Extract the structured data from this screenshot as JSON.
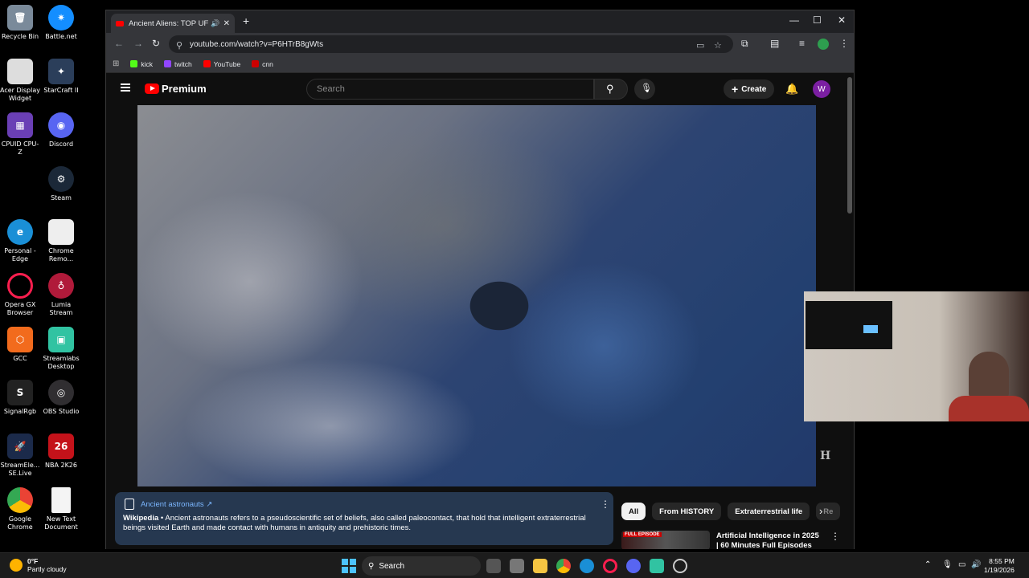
{
  "desktop": {
    "icons": [
      {
        "label": "Recycle Bin"
      },
      {
        "label": "Battle.net"
      },
      {
        "label": "Acer Display Widget"
      },
      {
        "label": "StarCraft II"
      },
      {
        "label": "CPUID CPU-Z"
      },
      {
        "label": "Discord"
      },
      {
        "label": "Steam"
      },
      {
        "label": "Personal - Edge"
      },
      {
        "label": "Chrome Remo..."
      },
      {
        "label": "Opera GX Browser"
      },
      {
        "label": "Lumia Stream"
      },
      {
        "label": "GCC"
      },
      {
        "label": "Streamlabs Desktop"
      },
      {
        "label": "SignalRgb"
      },
      {
        "label": "OBS Studio"
      },
      {
        "label": "StreamEle... SE.Live"
      },
      {
        "label": "NBA 2K26"
      },
      {
        "label": "Google Chrome"
      },
      {
        "label": "New Text Document"
      }
    ]
  },
  "browser": {
    "tab_title": "Ancient Aliens: TOP UFO M",
    "url": "youtube.com/watch?v=P6HTrB8gWts",
    "bookmarks": [
      "kick",
      "twitch",
      "YouTube",
      "cnn"
    ],
    "bookmark_colors": [
      "#53fc18",
      "#9146ff",
      "#ff0000",
      "#cc0000"
    ]
  },
  "youtube": {
    "brand": "Premium",
    "search_placeholder": "Search",
    "create_label": "Create",
    "avatar_letter": "W",
    "watermark": "H",
    "wiki": {
      "title": "Ancient astronauts",
      "source": "Wikipedia",
      "text": "Ancient astronauts refers to a pseudoscientific set of beliefs, also called paleocontact, that hold that intelligent extraterrestrial beings visited Earth and made contact with humans in antiquity and prehistoric times."
    },
    "chips": [
      "All",
      "From HISTORY",
      "Extraterrestrial life",
      "Re"
    ],
    "rec": {
      "badge": "FULL EPISODE",
      "title": "Artificial Intelligence in 2025 | 60 Minutes Full Episodes"
    }
  },
  "taskbar": {
    "temp": "0°F",
    "weather": "Partly cloudy",
    "search_label": "Search",
    "time": "8:55 PM",
    "date": "1/19/2026"
  }
}
